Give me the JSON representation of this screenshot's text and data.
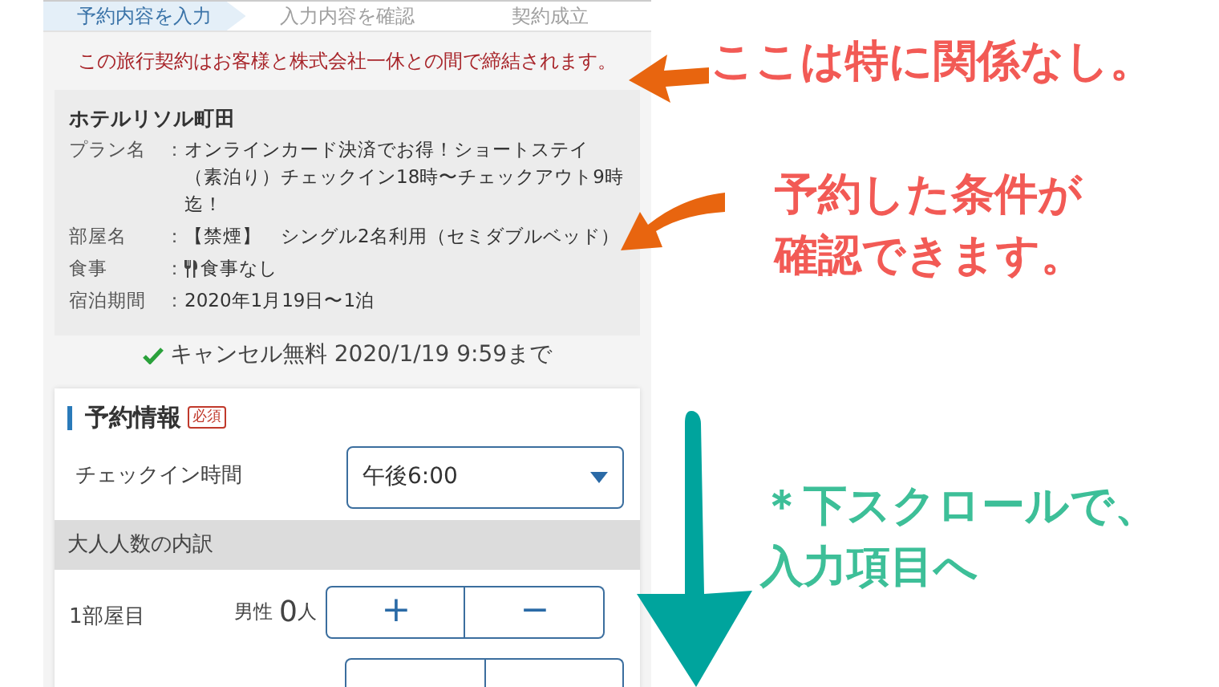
{
  "steps": [
    {
      "label": "予約内容を入力",
      "selected": true
    },
    {
      "label": "入力内容を確認",
      "selected": false
    },
    {
      "label": "契約成立",
      "selected": false
    }
  ],
  "notice": "この旅行契約はお客様と株式会社一休との間で締結されます。",
  "hotel": {
    "name": "ホテルリソル町田",
    "separator": "：",
    "details": [
      {
        "label": "プラン名",
        "value": "オンラインカード決済でお得！ショートステイ（素泊り）チェックイン18時〜チェックアウト9時迄！",
        "kind": "text"
      },
      {
        "label": "部屋名",
        "value": "【禁煙】　シングル2名利用（セミダブルベッド）",
        "kind": "text"
      },
      {
        "label": "食事",
        "value": "食事なし",
        "kind": "meal"
      },
      {
        "label": "宿泊期間",
        "value": "2020年1月19日〜1泊",
        "kind": "text"
      }
    ]
  },
  "cancel": "キャンセル無料 2020/1/19 9:59まで",
  "reservation": {
    "title": "予約情報",
    "badge": "必須",
    "checkin": {
      "label": "チェックイン時間",
      "value": "午後6:00"
    },
    "section_header": "大人人数の内訳",
    "rooms": [
      {
        "label": "1部屋目",
        "gender": "男性",
        "count": "0",
        "unit": "人",
        "plus": "+",
        "minus": "−"
      }
    ]
  },
  "annotations": [
    {
      "lines": [
        "ここは特に関係なし。"
      ],
      "color": "#f25a55"
    },
    {
      "lines": [
        "予約した条件が",
        "確認できます。"
      ],
      "color": "#f25a55"
    },
    {
      "lines": [
        "＊下スクロールで、",
        "入力項目へ"
      ],
      "color": "#3dbf98"
    }
  ]
}
